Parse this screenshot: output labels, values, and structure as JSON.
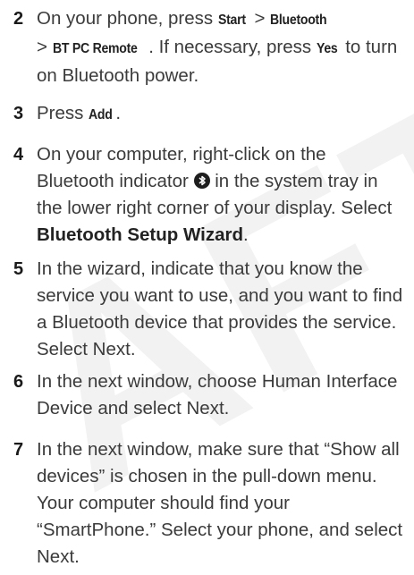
{
  "watermark": "AFT",
  "steps": [
    {
      "number": "2",
      "t1": "On your phone, press ",
      "k1": "Start",
      "t2": " > ",
      "k2": "Bluetooth",
      "t3": " > ",
      "k3": "BT PC Remote",
      "t4": ". If necessary, press ",
      "k4": "Yes",
      "t5": " to turn on Bluetooth power."
    },
    {
      "number": "3",
      "t1": "Press ",
      "k1": "Add",
      "t2": "."
    },
    {
      "number": "4",
      "t1": "On your computer, right-click on the Bluetooth indicator ",
      "icon": "bluetooth-icon",
      "t2": " in the system tray in the lower right corner of your display. Select ",
      "b1": "Bluetooth Setup Wizard",
      "t3": "."
    },
    {
      "number": "5",
      "text": "In the wizard, indicate that you know the service you want to use, and you want to find a Bluetooth device that provides the service. Select Next."
    },
    {
      "number": "6",
      "text": "In the next window, choose Human Interface Device and select Next."
    },
    {
      "number": "7",
      "text": "In the next window, make sure that “Show all devices” is chosen in the pull-down menu. Your computer should find your “SmartPhone.” Select your phone, and select Next."
    }
  ]
}
